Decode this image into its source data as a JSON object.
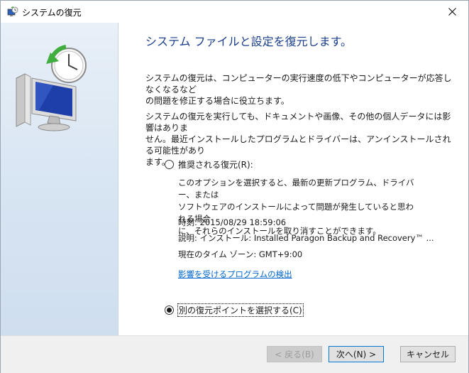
{
  "window": {
    "title": "システムの復元"
  },
  "heading": "システム ファイルと設定を復元します。",
  "paragraphs": [
    "システムの復元は、コンピューターの実行速度の低下やコンピューターが応答しなくなるなど\nの問題を修正する場合に役立ちます。",
    "システムの復元を実行しても、ドキュメントや画像、その他の個人データには影響はありま\nせん。最近インストールしたプログラムとドライバーは、アンインストールされる可能性があり\nます。"
  ],
  "options": {
    "recommended": {
      "label": "推奨される復元(R):",
      "selected": false,
      "description": "このオプションを選択すると、最新の更新プログラム、ドライバー、または\nソフトウェアのインストールによって問題が発生していると思われる場合\nに、それらのインストールを取り消すことができます。",
      "time": "時刻: 2015/08/29 18:59:06",
      "details": "説明: インストール: Installed Paragon Backup and Recovery™ ...",
      "timezone": "現在のタイム ゾーン: GMT+9:00",
      "link": "影響を受けるプログラムの検出"
    },
    "other": {
      "label": "別の復元ポイントを選択する(C)",
      "selected": true
    }
  },
  "buttons": {
    "back": "< 戻る(B)",
    "next": "次へ(N) >",
    "cancel": "キャンセル"
  },
  "colors": {
    "heading": "#1a3e8a",
    "link": "#0066cc",
    "primary_border": "#0078d7"
  },
  "icons": {
    "title": "system-restore-icon",
    "sidebar": "computer-clock-restore-icon",
    "close": "close-icon"
  }
}
